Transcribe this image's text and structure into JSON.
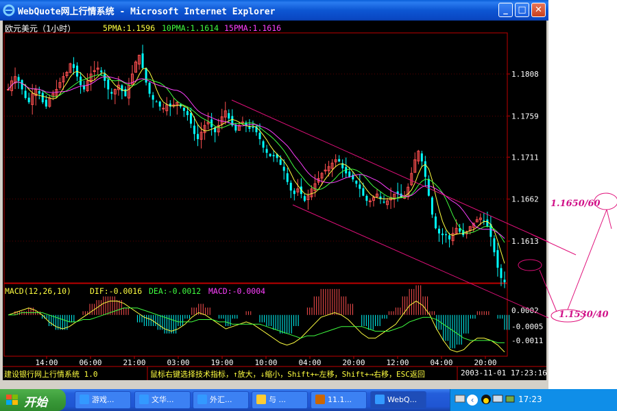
{
  "window": {
    "title": "WebQuote网上行情系统 - Microsoft Internet Explorer",
    "buttons": {
      "minimize": "_",
      "maximize": "□",
      "close": "✕"
    }
  },
  "chart_header": {
    "symbol": "欧元美元（1小时）",
    "ma5": "5PMA:1.1596",
    "ma10": "10PMA:1.1614",
    "ma15": "15PMA:1.1616",
    "colors": {
      "ma5": "#ffff40",
      "ma10": "#40ff40",
      "ma15": "#ff40ff",
      "up": "#ff5050",
      "down": "#00ffff",
      "axis": "#c00000"
    }
  },
  "macd_header": {
    "name": "MACD(12,26,10)",
    "dif": "DIF:-0.0016",
    "dea": "DEA:-0.0012",
    "macd": "MACD:-0.0004"
  },
  "status_bar": {
    "left": "建设银行网上行情系统 1.0",
    "middle": "鼠标右键选择技术指标，↑放大，↓缩小，Shift+←左移，Shift+→右移，ESC返回",
    "right": "2003-11-01 17:23:16"
  },
  "annotations": {
    "target_high": "1.1650/60",
    "target_low": "1.1530/40"
  },
  "chart_data": {
    "type": "candlestick",
    "title": "欧元美元（1小时）",
    "price_ticks": [
      "1.1808",
      "1.1759",
      "1.1711",
      "1.1662",
      "1.1613"
    ],
    "macd_ticks": [
      "0.0002",
      "-0.0005",
      "-0.0011"
    ],
    "time_ticks": [
      "14:00",
      "06:00",
      "21:00",
      "03:00",
      "19:00",
      "10:00",
      "04:00",
      "20:00",
      "12:00",
      "04:00",
      "20:00"
    ],
    "close_path": [
      1.179,
      1.18,
      1.1805,
      1.18,
      1.179,
      1.178,
      1.1775,
      1.1785,
      1.179,
      1.1785,
      1.1775,
      1.177,
      1.178,
      1.1785,
      1.179,
      1.1798,
      1.1805,
      1.181,
      1.182,
      1.1815,
      1.1805,
      1.1795,
      1.179,
      1.18,
      1.1808,
      1.1812,
      1.1815,
      1.181,
      1.18,
      1.179,
      1.1785,
      1.179,
      1.1795,
      1.1788,
      1.1782,
      1.1795,
      1.1808,
      1.1822,
      1.183,
      1.1815,
      1.1798,
      1.1785,
      1.1778,
      1.1775,
      1.177,
      1.1768,
      1.1772,
      1.177,
      1.1772,
      1.1775,
      1.177,
      1.1765,
      1.176,
      1.175,
      1.1738,
      1.1732,
      1.174,
      1.1748,
      1.1752,
      1.1746,
      1.174,
      1.1748,
      1.1758,
      1.1765,
      1.1756,
      1.1748,
      1.1742,
      1.1748,
      1.1752,
      1.1748,
      1.1744,
      1.1745,
      1.174,
      1.1732,
      1.1722,
      1.1716,
      1.1712,
      1.1712,
      1.171,
      1.1702,
      1.1695,
      1.1682,
      1.1672,
      1.1668,
      1.1674,
      1.1668,
      1.166,
      1.1666,
      1.1674,
      1.168,
      1.1686,
      1.1692,
      1.1696,
      1.17,
      1.1704,
      1.1708,
      1.1706,
      1.1698,
      1.1692,
      1.1688,
      1.1685,
      1.168,
      1.1674,
      1.1666,
      1.166,
      1.166,
      1.1664,
      1.1668,
      1.1662,
      1.1658,
      1.166,
      1.1664,
      1.1668,
      1.1668,
      1.1664,
      1.1664,
      1.1676,
      1.1692,
      1.1708,
      1.1718,
      1.1706,
      1.1688,
      1.1666,
      1.1644,
      1.1628,
      1.1622,
      1.162,
      1.162,
      1.1615,
      1.1622,
      1.1628,
      1.1624,
      1.162,
      1.1624,
      1.163,
      1.1634,
      1.1638,
      1.164,
      1.1637,
      1.163,
      1.1618,
      1.16,
      1.1582,
      1.157,
      1.1565
    ],
    "macd_series": {
      "dif": [
        0.0,
        0.0001,
        0.0002,
        0.0003,
        0.0002,
        0.0,
        -0.0003,
        -0.0005,
        -0.0006,
        -0.0005,
        -0.0003,
        -0.0001,
        0.0001,
        0.0003,
        0.0005,
        0.0006,
        0.0006,
        0.0005,
        0.0003,
        0.0001,
        -0.0001,
        -0.0002,
        -0.0004,
        -0.0006,
        -0.0007,
        -0.0006,
        -0.0004,
        -0.0001,
        0.0001,
        0.0,
        -0.0002,
        -0.0004,
        -0.0006,
        -0.0005,
        -0.0004,
        -0.0003,
        -0.0004,
        -0.0006,
        -0.0008,
        -0.001,
        -0.0012,
        -0.0013,
        -0.0012,
        -0.001,
        -0.0007,
        -0.0004,
        -0.0001,
        0.0,
        0.0001,
        0.0,
        -0.0002,
        -0.0005,
        -0.0008,
        -0.001,
        -0.001,
        -0.0008,
        -0.0006,
        -0.0004,
        0.0,
        0.0004,
        0.0006,
        0.0004,
        0.0,
        -0.0006,
        -0.0011,
        -0.0015,
        -0.0016,
        -0.0015,
        -0.0012,
        -0.001,
        -0.001,
        -0.0011,
        -0.0013,
        -0.0016
      ],
      "dea": [
        0.0,
        0.0,
        0.0001,
        0.0001,
        0.0001,
        0.0001,
        0.0,
        -0.0001,
        -0.0002,
        -0.0003,
        -0.0003,
        -0.0002,
        -0.0002,
        -0.0001,
        0.0,
        0.0001,
        0.0002,
        0.0003,
        0.0003,
        0.0003,
        0.0002,
        0.0001,
        0.0,
        -0.0001,
        -0.0002,
        -0.0003,
        -0.0003,
        -0.0003,
        -0.0002,
        -0.0002,
        -0.0002,
        -0.0003,
        -0.0003,
        -0.0004,
        -0.0004,
        -0.0004,
        -0.0004,
        -0.0004,
        -0.0005,
        -0.0006,
        -0.0007,
        -0.0008,
        -0.0009,
        -0.001,
        -0.0009,
        -0.0009,
        -0.0008,
        -0.0007,
        -0.0006,
        -0.0005,
        -0.0005,
        -0.0005,
        -0.0005,
        -0.0006,
        -0.0007,
        -0.0007,
        -0.0007,
        -0.0006,
        -0.0005,
        -0.0003,
        -0.0002,
        -0.0001,
        -0.0001,
        -0.0002,
        -0.0004,
        -0.0006,
        -0.0008,
        -0.001,
        -0.0011,
        -0.0011,
        -0.0011,
        -0.0011,
        -0.0012,
        -0.0012
      ]
    }
  }
}
